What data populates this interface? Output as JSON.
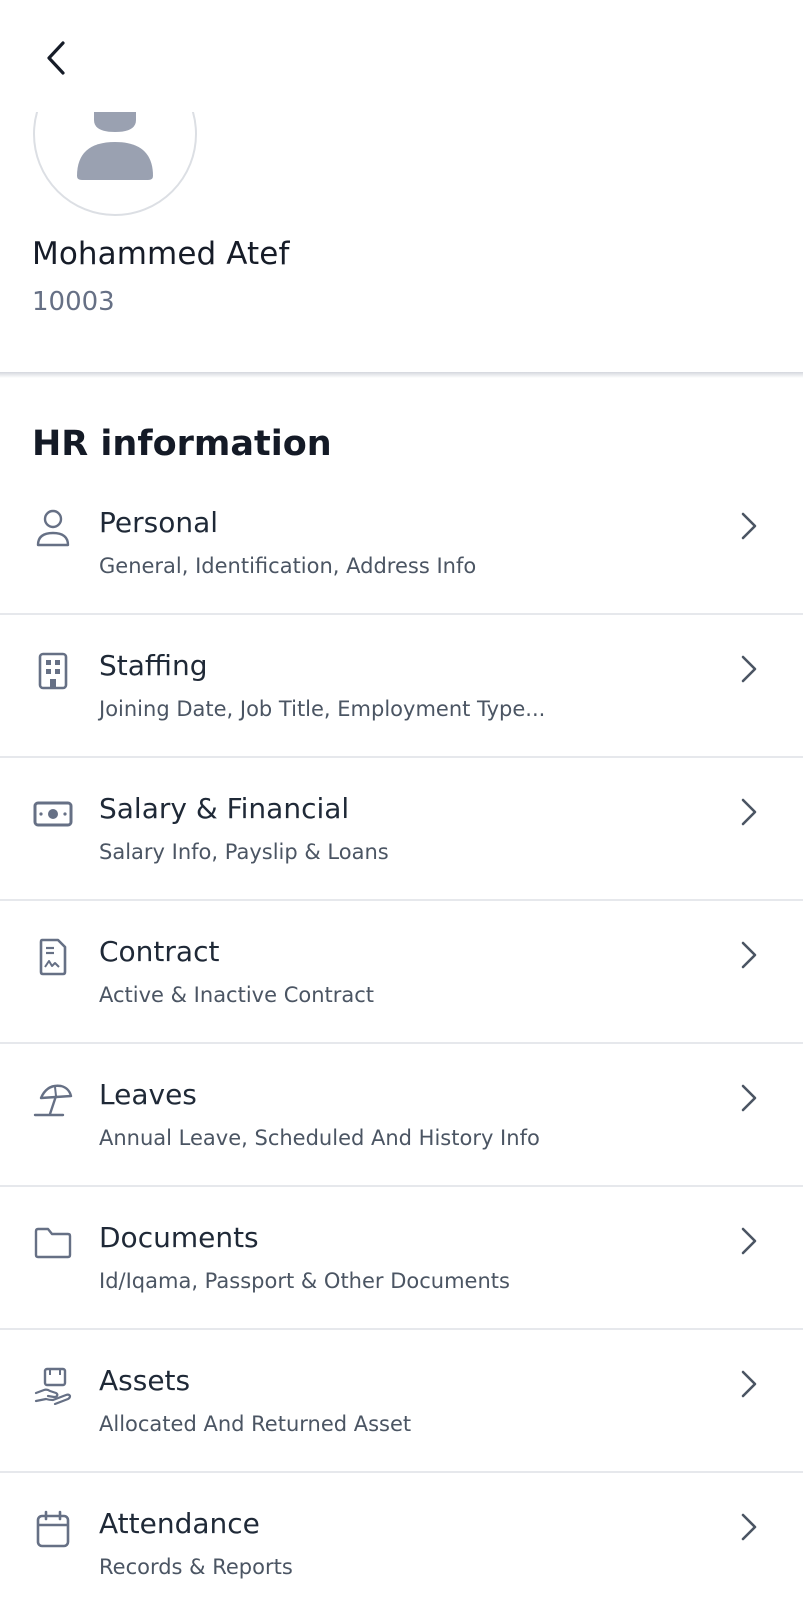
{
  "profile": {
    "name": "Mohammed Atef",
    "employee_id": "10003"
  },
  "section_title": "HR information",
  "menu": [
    {
      "title": "Personal",
      "subtitle": "General, Identification, Address Info",
      "icon": "user-icon"
    },
    {
      "title": "Staffing",
      "subtitle": "Joining Date, Job Title, Employment Type...",
      "icon": "building-icon"
    },
    {
      "title": "Salary & Financial",
      "subtitle": "Salary Info, Payslip & Loans",
      "icon": "money-icon"
    },
    {
      "title": "Contract",
      "subtitle": "Active & Inactive Contract",
      "icon": "contract-icon"
    },
    {
      "title": "Leaves",
      "subtitle": "Annual Leave, Scheduled And History Info",
      "icon": "umbrella-icon"
    },
    {
      "title": "Documents",
      "subtitle": "Id/Iqama, Passport & Other Documents",
      "icon": "folder-icon"
    },
    {
      "title": "Assets",
      "subtitle": "Allocated And Returned Asset",
      "icon": "asset-hand-icon"
    },
    {
      "title": "Attendance",
      "subtitle": "Records & Reports",
      "icon": "calendar-icon"
    }
  ],
  "colors": {
    "icon_gray": "#667085",
    "avatar_fill": "#9aa1b1",
    "divider": "#e6e8ec"
  }
}
